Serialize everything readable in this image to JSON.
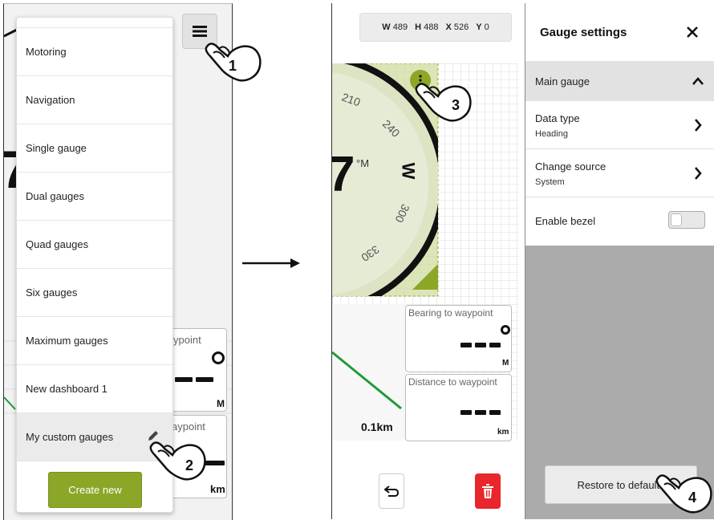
{
  "left": {
    "menu_items": [
      {
        "label": "Motoring"
      },
      {
        "label": "Navigation"
      },
      {
        "label": "Single gauge"
      },
      {
        "label": "Dual gauges"
      },
      {
        "label": "Quad gauges"
      },
      {
        "label": "Six gauges"
      },
      {
        "label": "Maximum gauges"
      },
      {
        "label": "New dashboard 1"
      },
      {
        "label": "My custom gauges"
      }
    ],
    "create_new": "Create new",
    "bg_cards": [
      {
        "title": "ypoint",
        "unit": "M"
      },
      {
        "title": "aypoint",
        "unit": "km"
      }
    ],
    "big_number": "7"
  },
  "right": {
    "dims": {
      "w_label": "W",
      "w": "489",
      "h_label": "H",
      "h": "488",
      "x_label": "X",
      "x": "526",
      "y_label": "Y",
      "y": "0"
    },
    "compass": {
      "ticks": [
        "210",
        "240",
        "W",
        "300",
        "330"
      ],
      "value": "7",
      "unit": "°M"
    },
    "cards": [
      {
        "title": "Bearing to waypoint",
        "unit": "M"
      },
      {
        "title": "Distance to waypoint",
        "unit": "km"
      }
    ],
    "scale": "0.1km",
    "panel": {
      "title": "Gauge settings",
      "section": "Main gauge",
      "data_type_label": "Data type",
      "data_type_value": "Heading",
      "source_label": "Change source",
      "source_value": "System",
      "bezel_label": "Enable bezel",
      "restore": "Restore to defaults"
    }
  },
  "steps": [
    "1",
    "2",
    "3",
    "4"
  ],
  "colors": {
    "accent_green": "#8ca627",
    "delete_red": "#e8262b",
    "route_green": "#1f9a3a"
  }
}
